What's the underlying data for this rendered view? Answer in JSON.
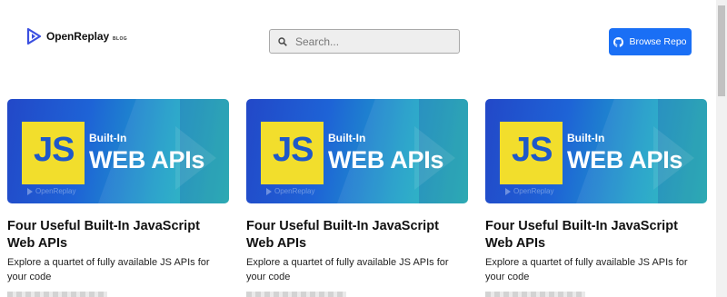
{
  "header": {
    "logo_name": "OpenReplay",
    "logo_tag": "BLOG",
    "search_placeholder": "Search...",
    "repo_button_label": "Browse Repo"
  },
  "colors": {
    "accent": "#1a6ff5",
    "js_yellow": "#f2de2c",
    "js_blue": "#1e58c9"
  },
  "cards": [
    {
      "thumb_builtin": "Built-In",
      "thumb_js": "JS",
      "thumb_webapis": "WEB APIs",
      "thumb_brand": "OpenReplay",
      "title": "Four Useful Built-In JavaScript Web APIs",
      "description": "Explore a quartet of fully available JS APIs for your code"
    },
    {
      "thumb_builtin": "Built-In",
      "thumb_js": "JS",
      "thumb_webapis": "WEB APIs",
      "thumb_brand": "OpenReplay",
      "title": "Four Useful Built-In JavaScript Web APIs",
      "description": "Explore a quartet of fully available JS APIs for your code"
    },
    {
      "thumb_builtin": "Built-In",
      "thumb_js": "JS",
      "thumb_webapis": "WEB APIs",
      "thumb_brand": "OpenReplay",
      "title": "Four Useful Built-In JavaScript Web APIs",
      "description": "Explore a quartet of fully available JS APIs for your code"
    }
  ]
}
